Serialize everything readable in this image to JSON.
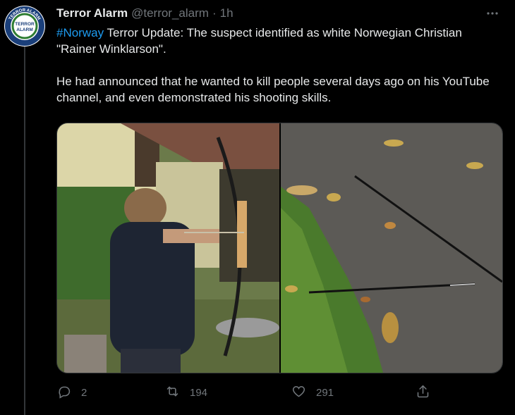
{
  "tweet": {
    "display_name": "Terror Alarm",
    "handle": "@terror_alarm",
    "separator": "·",
    "time": "1h",
    "more_label": "···",
    "hashtag": "#Norway",
    "line1_rest": " Terror Update: The suspect identified as white Norwegian Christian \"Rainer Winklarson\".",
    "paragraph2": "He had announced that he wanted to kill people several days ago on his YouTube channel, and even demonstrated his shooting skills."
  },
  "avatar": {
    "ring_text_top": "TERROR ALARM",
    "center_text_1": "TERROR",
    "center_text_2": "ALARM"
  },
  "actions": {
    "reply": {
      "icon": "reply-icon",
      "count": "2"
    },
    "retweet": {
      "icon": "retweet-icon",
      "count": "194"
    },
    "like": {
      "icon": "heart-icon",
      "count": "291"
    },
    "share": {
      "icon": "share-icon",
      "count": ""
    }
  },
  "colors": {
    "background": "#000000",
    "text": "#e7e9ea",
    "secondary": "#71767b",
    "link": "#1d9bf0",
    "avatar_ring": "#1a3f7a"
  }
}
